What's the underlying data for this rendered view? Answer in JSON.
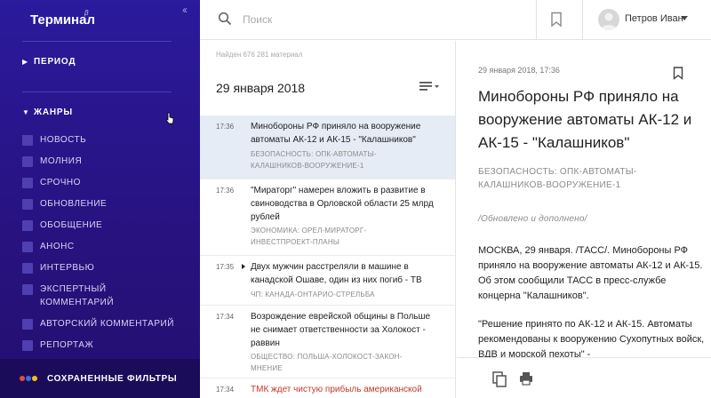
{
  "app": {
    "title": "Терминал",
    "beta": "β"
  },
  "sidebar": {
    "period_label": "ПЕРИОД",
    "genres_label": "ЖАНРЫ",
    "genres": [
      "НОВОСТЬ",
      "МОЛНИЯ",
      "СРОЧНО",
      "ОБНОВЛЕНИЕ",
      "ОБОБЩЕНИЕ",
      "АНОНС",
      "ИНТЕРВЬЮ",
      "ЭКСПЕРТНЫЙ КОММЕНТАРИЙ",
      "АВТОРСКИЙ КОММЕНТАРИЙ",
      "РЕПОРТАЖ"
    ],
    "saved_filters_label": "СОХРАНЕННЫЕ ФИЛЬТРЫ",
    "saved_dot_colors": [
      "#e74c3c",
      "#3b6fe0",
      "#f1c40f"
    ],
    "collapse_icon": "double-chevron-left"
  },
  "search": {
    "placeholder": "Поиск",
    "value": ""
  },
  "user": {
    "name": "Петров Иван"
  },
  "list": {
    "found_text": "Найден 676 281 материал",
    "date_heading": "29 января 2018",
    "items": [
      {
        "time": "17:36",
        "title": "Минобороны РФ приняло на вооружение автоматы АК-12 и АК-15 - \"Калашников\"",
        "tags": "БЕЗОПАСНОСТЬ: ОПК-АВТОМАТЫ-КАЛАШНИКОВ-ВООРУЖЕНИЕ-1",
        "selected": true
      },
      {
        "time": "17:36",
        "title": "\"Мираторг\" намерен вложить в развитие в свиноводства в Орловской области 25 млрд рублей",
        "tags": "ЭКОНОМИКА: ОРЕЛ-МИРАТОРГ-ИНВЕСТПРОЕКТ-ПЛАНЫ"
      },
      {
        "time": "17:35",
        "title": "Двух мужчин расстреляли в машине в канадской Ошаве, один из них погиб - ТВ",
        "tags": "ЧП: КАНАДА-ОНТАРИО-СТРЕЛЬБА"
      },
      {
        "time": "17:34",
        "title": "Возрождение еврейской общины в Польше не снимает ответственности за Холокост - раввин",
        "tags": "ОБЩЕСТВО: ПОЛЬША-ХОЛОКОСТ-ЗАКОН-МНЕНИЕ"
      },
      {
        "time": "17:34",
        "title": "ТМК ждет чистую прибыль американской",
        "tags": ""
      }
    ]
  },
  "article": {
    "date": "29 января 2018, 17:36",
    "title": "Минобороны РФ приняло на вооружение автоматы АК-12 и АК-15 - \"Калашников\"",
    "tags": "БЕЗОПАСНОСТЬ: ОПК-АВТОМАТЫ-КАЛАШНИКОВ-ВООРУЖЕНИЕ-1",
    "note": "/Обновлено и дополнено/",
    "para1": "МОСКВА, 29 января. /ТАСС/. Минобороны РФ приняло на вооружение автоматы АК-12 и АК-15. Об этом сообщили ТАСС в пресс-службе концерна \"Калашников\".",
    "para2": "\"Решение принято по АК-12 и АК-15. Автоматы рекомендованы к вооружению Сухопутных войск, ВДВ и морской пехоты\" -"
  },
  "colors": {
    "sidebar_bg": "#2a1a9c",
    "selected_row": "#e6ecf6",
    "accent_red": "#c0392b"
  }
}
